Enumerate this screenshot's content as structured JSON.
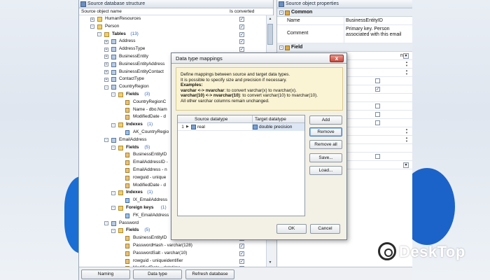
{
  "left_panel": {
    "title": "Source database structure",
    "col_object": "Source object name",
    "col_converted": "Is converted",
    "rows": [
      {
        "label": "HumanResources",
        "count": "",
        "indent": 1,
        "expander": "+",
        "icon": "folder",
        "bold": false,
        "checked": true
      },
      {
        "label": "Person",
        "count": "",
        "indent": 1,
        "expander": "-",
        "icon": "folder",
        "bold": false,
        "checked": true
      },
      {
        "label": "Tables",
        "count": "(13)",
        "indent": 2,
        "expander": "-",
        "icon": "folder",
        "bold": true,
        "checked": true
      },
      {
        "label": "Address",
        "count": "",
        "indent": 3,
        "expander": "+",
        "icon": "table",
        "bold": false,
        "checked": true
      },
      {
        "label": "AddressType",
        "count": "",
        "indent": 3,
        "expander": "+",
        "icon": "table",
        "bold": false,
        "checked": true
      },
      {
        "label": "BusinessEntity",
        "count": "",
        "indent": 3,
        "expander": "+",
        "icon": "table",
        "bold": false,
        "checked": true
      },
      {
        "label": "BusinessEntityAddress",
        "count": "",
        "indent": 3,
        "expander": "+",
        "icon": "table",
        "bold": false,
        "checked": true
      },
      {
        "label": "BusinessEntityContact",
        "count": "",
        "indent": 3,
        "expander": "+",
        "icon": "table",
        "bold": false,
        "checked": true
      },
      {
        "label": "ContactType",
        "count": "",
        "indent": 3,
        "expander": "+",
        "icon": "table",
        "bold": false,
        "checked": true
      },
      {
        "label": "CountryRegion",
        "count": "",
        "indent": 3,
        "expander": "-",
        "icon": "table",
        "bold": false,
        "checked": true
      },
      {
        "label": "Fields",
        "count": "(3)",
        "indent": 4,
        "expander": "-",
        "icon": "folder",
        "bold": true,
        "checked": false
      },
      {
        "label": "CountryRegionC",
        "count": "",
        "indent": 5,
        "expander": "",
        "icon": "col",
        "bold": false,
        "checked": false
      },
      {
        "label": "Name - dbo.Nam",
        "count": "",
        "indent": 5,
        "expander": "",
        "icon": "col",
        "bold": false,
        "checked": false
      },
      {
        "label": "ModifiedDate - d",
        "count": "",
        "indent": 5,
        "expander": "",
        "icon": "col",
        "bold": false,
        "checked": false
      },
      {
        "label": "Indexes",
        "count": "(1)",
        "indent": 4,
        "expander": "-",
        "icon": "folder",
        "bold": true,
        "checked": false
      },
      {
        "label": "AK_CountryRegio",
        "count": "",
        "indent": 5,
        "expander": "",
        "icon": "idx",
        "bold": false,
        "checked": false
      },
      {
        "label": "EmailAddress",
        "count": "",
        "indent": 3,
        "expander": "-",
        "icon": "table",
        "bold": false,
        "checked": false
      },
      {
        "label": "Fields",
        "count": "(5)",
        "indent": 4,
        "expander": "-",
        "icon": "folder",
        "bold": true,
        "checked": false
      },
      {
        "label": "BusinessEntityID",
        "count": "",
        "indent": 5,
        "expander": "",
        "icon": "col",
        "bold": false,
        "checked": false
      },
      {
        "label": "EmailAddressID -",
        "count": "",
        "indent": 5,
        "expander": "",
        "icon": "col",
        "bold": false,
        "checked": false
      },
      {
        "label": "EmailAddress - n",
        "count": "",
        "indent": 5,
        "expander": "",
        "icon": "col",
        "bold": false,
        "checked": false
      },
      {
        "label": "rowguid - unique",
        "count": "",
        "indent": 5,
        "expander": "",
        "icon": "col",
        "bold": false,
        "checked": false
      },
      {
        "label": "ModifiedDate - d",
        "count": "",
        "indent": 5,
        "expander": "",
        "icon": "col",
        "bold": false,
        "checked": false
      },
      {
        "label": "Indexes",
        "count": "(1)",
        "indent": 4,
        "expander": "-",
        "icon": "folder",
        "bold": true,
        "checked": false
      },
      {
        "label": "IX_EmailAddress",
        "count": "",
        "indent": 5,
        "expander": "",
        "icon": "idx",
        "bold": false,
        "checked": false
      },
      {
        "label": "Foreign keys",
        "count": "(1)",
        "indent": 4,
        "expander": "-",
        "icon": "folder",
        "bold": true,
        "checked": false
      },
      {
        "label": "FK_EmailAddress",
        "count": "",
        "indent": 5,
        "expander": "",
        "icon": "idx",
        "bold": false,
        "checked": false
      },
      {
        "label": "Password",
        "count": "",
        "indent": 3,
        "expander": "-",
        "icon": "table",
        "bold": false,
        "checked": false
      },
      {
        "label": "Fields",
        "count": "(5)",
        "indent": 4,
        "expander": "-",
        "icon": "folder",
        "bold": true,
        "checked": false
      },
      {
        "label": "BusinessEntityID",
        "count": "",
        "indent": 5,
        "expander": "",
        "icon": "col",
        "bold": false,
        "checked": true
      },
      {
        "label": "PasswordHash - varchar(128)",
        "count": "",
        "indent": 5,
        "expander": "",
        "icon": "col",
        "bold": false,
        "checked": true
      },
      {
        "label": "PasswordSalt - varchar(10)",
        "count": "",
        "indent": 5,
        "expander": "",
        "icon": "col",
        "bold": false,
        "checked": true
      },
      {
        "label": "rowguid - uniqueidentifier",
        "count": "",
        "indent": 5,
        "expander": "",
        "icon": "col",
        "bold": false,
        "checked": true
      },
      {
        "label": "ModifiedDate - datetime",
        "count": "",
        "indent": 5,
        "expander": "",
        "icon": "col",
        "bold": false,
        "checked": true
      }
    ]
  },
  "right_panel": {
    "title": "Source object properties",
    "section_common": "Common",
    "section_field": "Field",
    "common_rows": [
      {
        "name": "Name",
        "value": "BusinessEntityID"
      },
      {
        "name": "Comment",
        "value": "Primary key. Person associated with this email"
      }
    ],
    "field_value_partial": "nt"
  },
  "toolbar": {
    "naming_label": "Naming conventions...",
    "mappings_label": "Data type mappings...",
    "refresh_label": "Refresh database"
  },
  "dialog": {
    "title": "Data type mappings",
    "close_glyph": "x",
    "info_line1": "Define mappings between source and target data types.",
    "info_line2": "It is possible to specify size and precision if necessary.",
    "examples_label": "Examples:",
    "ex1_code": "varchar <-> nvarchar",
    "ex1_desc": ": to convert varchar(x) to nvarchar(x).",
    "ex2_code": "varchar(10) <-> nvarchar(10)",
    "ex2_desc": ": to convert varchar(10) to nvarchar(10).",
    "info_line_last": "All other varchar columns remain unchanged.",
    "col_source": "Source datatype",
    "col_target": "Target datatype",
    "rows": [
      {
        "num": "1",
        "source": "real",
        "target": "double precision"
      }
    ],
    "add_label": "Add",
    "remove_label": "Remove",
    "remove_all_label": "Remove all",
    "save_label": "Save...",
    "load_label": "Load...",
    "ok_label": "OK",
    "cancel_label": "Cancel"
  },
  "watermark": {
    "text": "DeskTop"
  },
  "colors": {
    "accent_blue": "#1a6ed4",
    "info_bg": "#fbf4d4",
    "close_red": "#c9473a",
    "selected_cell": "#dce6f5"
  }
}
